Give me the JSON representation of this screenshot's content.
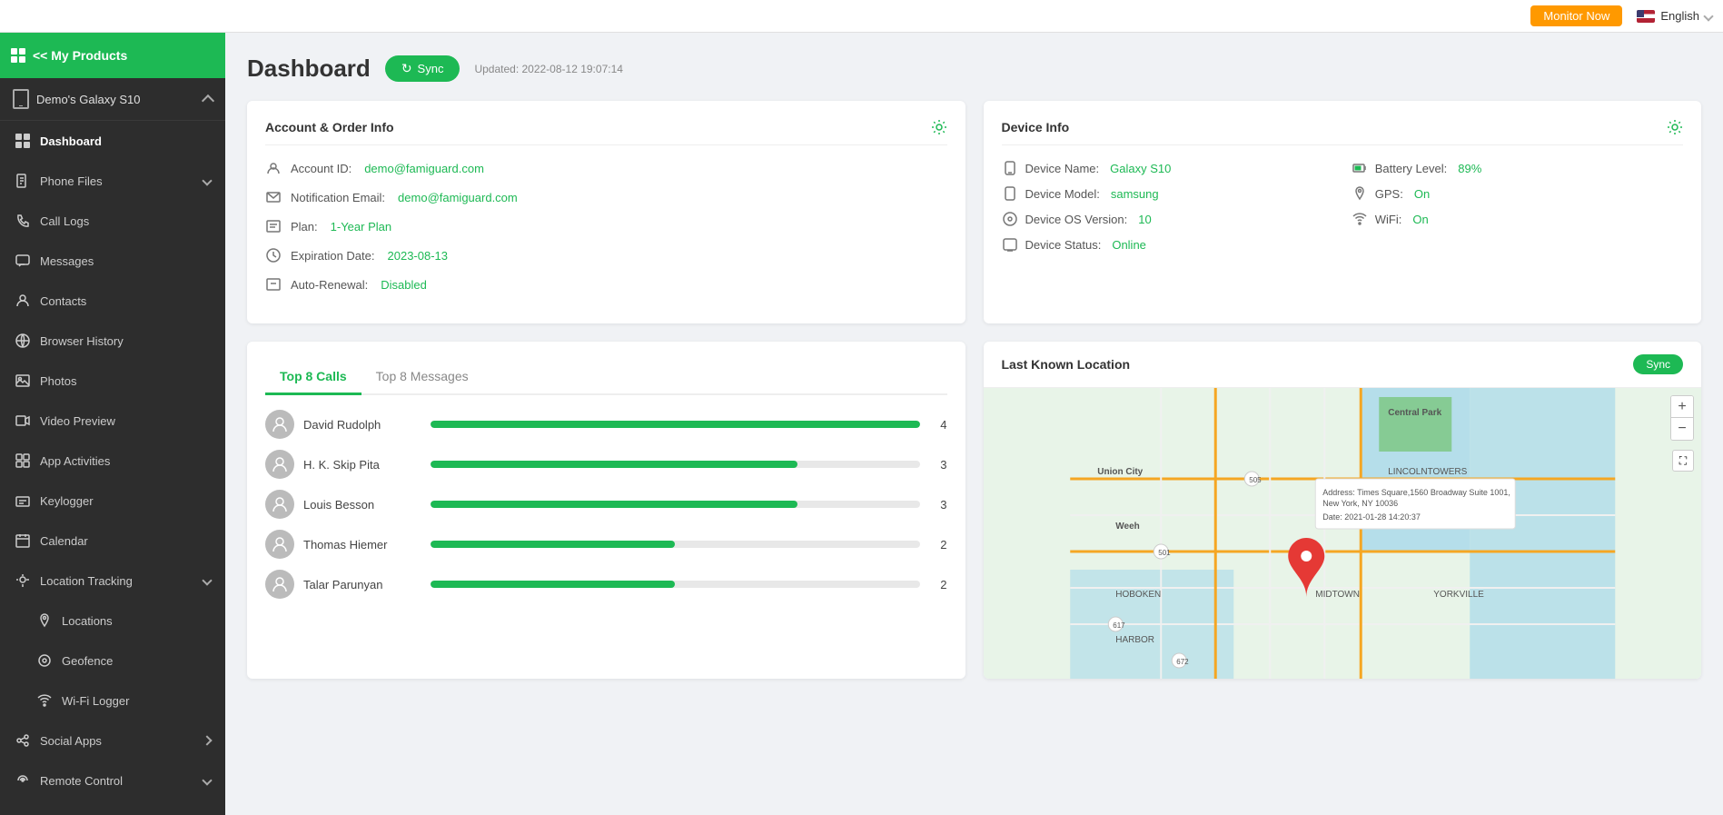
{
  "topbar": {
    "monitor_now": "Monitor Now",
    "language": "English"
  },
  "sidebar": {
    "my_products": "<< My Products",
    "device_name": "Demo's Galaxy S10",
    "nav_items": [
      {
        "id": "dashboard",
        "label": "Dashboard",
        "active": true,
        "icon": "dashboard"
      },
      {
        "id": "phone-files",
        "label": "Phone Files",
        "icon": "phone-files",
        "has_sub": true
      },
      {
        "id": "call-logs",
        "label": "Call Logs",
        "icon": "call-logs"
      },
      {
        "id": "messages",
        "label": "Messages",
        "icon": "messages"
      },
      {
        "id": "contacts",
        "label": "Contacts",
        "icon": "contacts"
      },
      {
        "id": "browser-history",
        "label": "Browser History",
        "icon": "browser"
      },
      {
        "id": "photos",
        "label": "Photos",
        "icon": "photos"
      },
      {
        "id": "video-preview",
        "label": "Video Preview",
        "icon": "video"
      },
      {
        "id": "app-activities",
        "label": "App Activities",
        "icon": "apps"
      },
      {
        "id": "keylogger",
        "label": "Keylogger",
        "icon": "keylogger"
      },
      {
        "id": "calendar",
        "label": "Calendar",
        "icon": "calendar"
      },
      {
        "id": "location-tracking",
        "label": "Location Tracking",
        "icon": "location",
        "has_sub": true
      },
      {
        "id": "locations",
        "label": "Locations",
        "icon": "pin",
        "is_sub": true
      },
      {
        "id": "geofence",
        "label": "Geofence",
        "icon": "geofence",
        "is_sub": true
      },
      {
        "id": "wifi-logger",
        "label": "Wi-Fi Logger",
        "icon": "wifi",
        "is_sub": true
      },
      {
        "id": "social-apps",
        "label": "Social Apps",
        "icon": "social",
        "has_sub": true
      },
      {
        "id": "remote-control",
        "label": "Remote Control",
        "icon": "remote",
        "has_sub": true
      }
    ]
  },
  "dashboard": {
    "title": "Dashboard",
    "sync_label": "Sync",
    "updated_text": "Updated: 2022-08-12 19:07:14",
    "account_card": {
      "title": "Account & Order Info",
      "account_id_label": "Account ID:",
      "account_id_value": "demo@famiguard.com",
      "notification_email_label": "Notification Email:",
      "notification_email_value": "demo@famiguard.com",
      "plan_label": "Plan:",
      "plan_value": "1-Year Plan",
      "expiration_label": "Expiration Date:",
      "expiration_value": "2023-08-13",
      "auto_renewal_label": "Auto-Renewal:",
      "auto_renewal_value": "Disabled"
    },
    "device_card": {
      "title": "Device Info",
      "device_name_label": "Device Name:",
      "device_name_value": "Galaxy S10",
      "battery_label": "Battery Level:",
      "battery_value": "89%",
      "device_model_label": "Device Model:",
      "device_model_value": "samsung",
      "gps_label": "GPS:",
      "gps_value": "On",
      "os_version_label": "Device OS Version:",
      "os_version_value": "10",
      "wifi_label": "WiFi:",
      "wifi_value": "On",
      "status_label": "Device Status:",
      "status_value": "Online"
    },
    "calls_tab": "Top 8 Calls",
    "messages_tab": "Top 8 Messages",
    "calls": [
      {
        "name": "David Rudolph",
        "count": 4,
        "bar_pct": 100
      },
      {
        "name": "H. K. Skip Pita",
        "count": 3,
        "bar_pct": 75
      },
      {
        "name": "Louis Besson",
        "count": 3,
        "bar_pct": 75
      },
      {
        "name": "Thomas Hiemer",
        "count": 2,
        "bar_pct": 50
      },
      {
        "name": "Talar Parunyan",
        "count": 2,
        "bar_pct": 50
      }
    ],
    "location_card": {
      "title": "Last Known Location",
      "sync_label": "Sync",
      "address_label": "Address:",
      "address_value": "Times Square, 1560 Broadway Suite 1001, New York, NY 10036",
      "date_label": "Date:",
      "date_value": "2021-01-28 14:20:37"
    }
  }
}
